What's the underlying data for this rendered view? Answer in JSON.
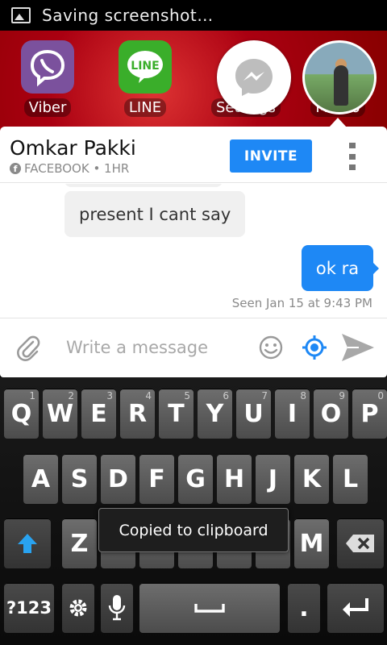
{
  "status_bar": {
    "text": "Saving screenshot…"
  },
  "home_apps": [
    {
      "label": "Viber",
      "color": "#7b519d"
    },
    {
      "label": "LINE",
      "color": "#3aae2a"
    },
    {
      "label": "Settings",
      "color": "#444444"
    },
    {
      "label": "Memo",
      "color": "#555555"
    }
  ],
  "chat": {
    "contact_name": "Omkar Pakki",
    "meta": "FACEBOOK • 1HR",
    "invite_label": "INVITE",
    "messages": [
      {
        "direction": "incoming",
        "text": "present I cant say"
      },
      {
        "direction": "outgoing",
        "text": "ok ra"
      }
    ],
    "seen": "Seen Jan 15 at 9:43 PM",
    "composer": {
      "placeholder": "Write a message",
      "value": ""
    }
  },
  "colors": {
    "accent": "#1e88f5",
    "bubble_in": "#f0f0f0",
    "meta_gray": "#8a8a8a"
  },
  "keyboard": {
    "row1": [
      {
        "label": "Q",
        "hint": "1"
      },
      {
        "label": "W",
        "hint": "2"
      },
      {
        "label": "E",
        "hint": "3"
      },
      {
        "label": "R",
        "hint": "4"
      },
      {
        "label": "T",
        "hint": "5"
      },
      {
        "label": "Y",
        "hint": "6"
      },
      {
        "label": "U",
        "hint": "7"
      },
      {
        "label": "I",
        "hint": "8"
      },
      {
        "label": "O",
        "hint": "9"
      },
      {
        "label": "P",
        "hint": "0"
      }
    ],
    "row2": [
      "A",
      "S",
      "D",
      "F",
      "G",
      "H",
      "J",
      "K",
      "L"
    ],
    "row3_visible": [
      "Z",
      "M"
    ],
    "symbols_label": "?123",
    "period_label": ".",
    "icons": [
      "shift-icon",
      "backspace-icon",
      "settings-icon",
      "mic-icon",
      "space-icon",
      "enter-icon"
    ]
  },
  "toast": {
    "text": "Copied to clipboard"
  }
}
